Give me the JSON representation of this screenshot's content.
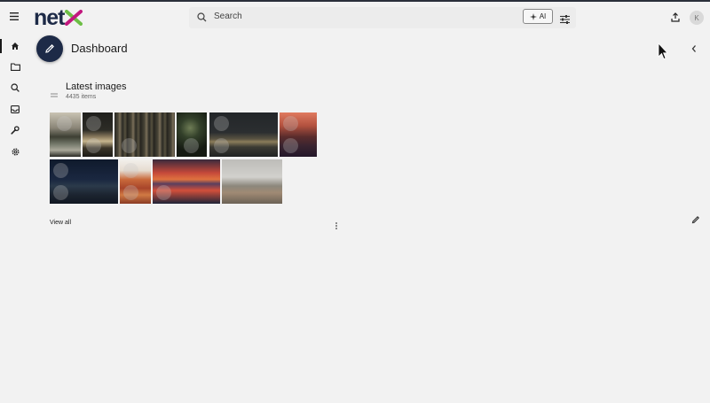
{
  "header": {
    "menu_icon": "hamburger-icon",
    "logo_text": "net",
    "logo_letter": "x",
    "search_placeholder": "Search",
    "ai_label": "AI",
    "upload_icon": "upload-icon",
    "filter_icon": "sliders-icon",
    "avatar_initial": "K"
  },
  "sidebar": {
    "items": [
      {
        "icon": "home-icon",
        "active": true
      },
      {
        "icon": "folder-icon",
        "active": false
      },
      {
        "icon": "search-icon",
        "active": false
      },
      {
        "icon": "inbox-icon",
        "active": false
      },
      {
        "icon": "wrench-icon",
        "active": false
      },
      {
        "icon": "gear-icon",
        "active": false
      }
    ]
  },
  "page": {
    "title": "Dashboard"
  },
  "widget": {
    "title": "Latest images",
    "count": "4435 items",
    "view_all": "View all"
  },
  "colors": {
    "brand_navy": "#1d2a47",
    "brand_green": "#6dbe45",
    "brand_magenta": "#c2187e",
    "background": "#f2f2f2"
  }
}
